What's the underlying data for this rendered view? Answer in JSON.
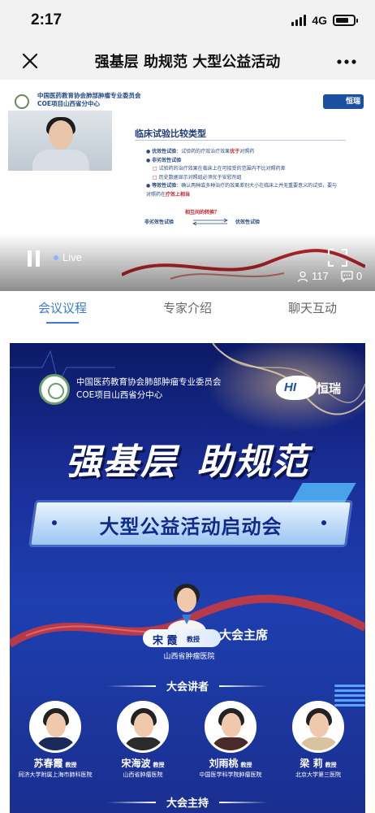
{
  "status_bar": {
    "time": "2:17",
    "network": "4G",
    "battery_level": 0.75
  },
  "nav": {
    "close_icon": "close-icon",
    "title": "强基层 助规范 大型公益活动",
    "more_icon": "more-icon"
  },
  "video": {
    "slide": {
      "org_line1": "中国医药教育协会肺部肿瘤专业委员会",
      "org_line2": "COE项目山西省分中心",
      "brand": "恒瑞",
      "title": "临床试验比较类型",
      "items": [
        {
          "label": "优效性试验",
          "text": "：试验药的疗效治疗效果",
          "em": "优于",
          "tail": "对照药"
        },
        {
          "label": "非劣效性试验",
          "text": "",
          "em": "",
          "tail": ""
        }
      ],
      "sub_items": [
        "试验药的治疗效果在临床上在可接受的范围内不比对照药差",
        "历史数据显示对照组必须优于安慰剂组"
      ],
      "equiv": {
        "label": "等效性试验",
        "text": "：确认两种或多种治疗的效果差别大小在临床上并无重要意义的试验，要与对照药在",
        "em": "疗效上相当"
      },
      "relation_question": "相互间的转换？",
      "relation_left": "非劣效性试验",
      "relation_right": "优效性试验"
    },
    "live_label": "Live",
    "viewers": "117",
    "comments": "0"
  },
  "tabs": [
    {
      "label": "会议议程",
      "active": true
    },
    {
      "label": "专家介绍",
      "active": false
    },
    {
      "label": "聊天互动",
      "active": false
    }
  ],
  "poster": {
    "org_line1": "中国医药教育协会肺部肿瘤专业委员会",
    "org_line2": "COE项目山西省分中心",
    "brand": "恒瑞",
    "slogan_part1": "强基层",
    "slogan_part2": "助规范",
    "banner": "大型公益活动启动会",
    "chair": {
      "name": "宋 霞",
      "title": "教授",
      "hospital": "山西省肿瘤医院",
      "role": "大会主席"
    },
    "speakers_title": "大会讲者",
    "speakers": [
      {
        "name": "苏春霞",
        "title": "教授",
        "hospital": "同济大学附属上海市肺科医院"
      },
      {
        "name": "宋海波",
        "title": "教授",
        "hospital": "山西省肿瘤医院"
      },
      {
        "name": "刘雨桃",
        "title": "教授",
        "hospital": "中国医学科学院肿瘤医院"
      },
      {
        "name": "梁 莉",
        "title": "教授",
        "hospital": "北京大学第三医院"
      }
    ],
    "hosts_title": "大会主持"
  }
}
